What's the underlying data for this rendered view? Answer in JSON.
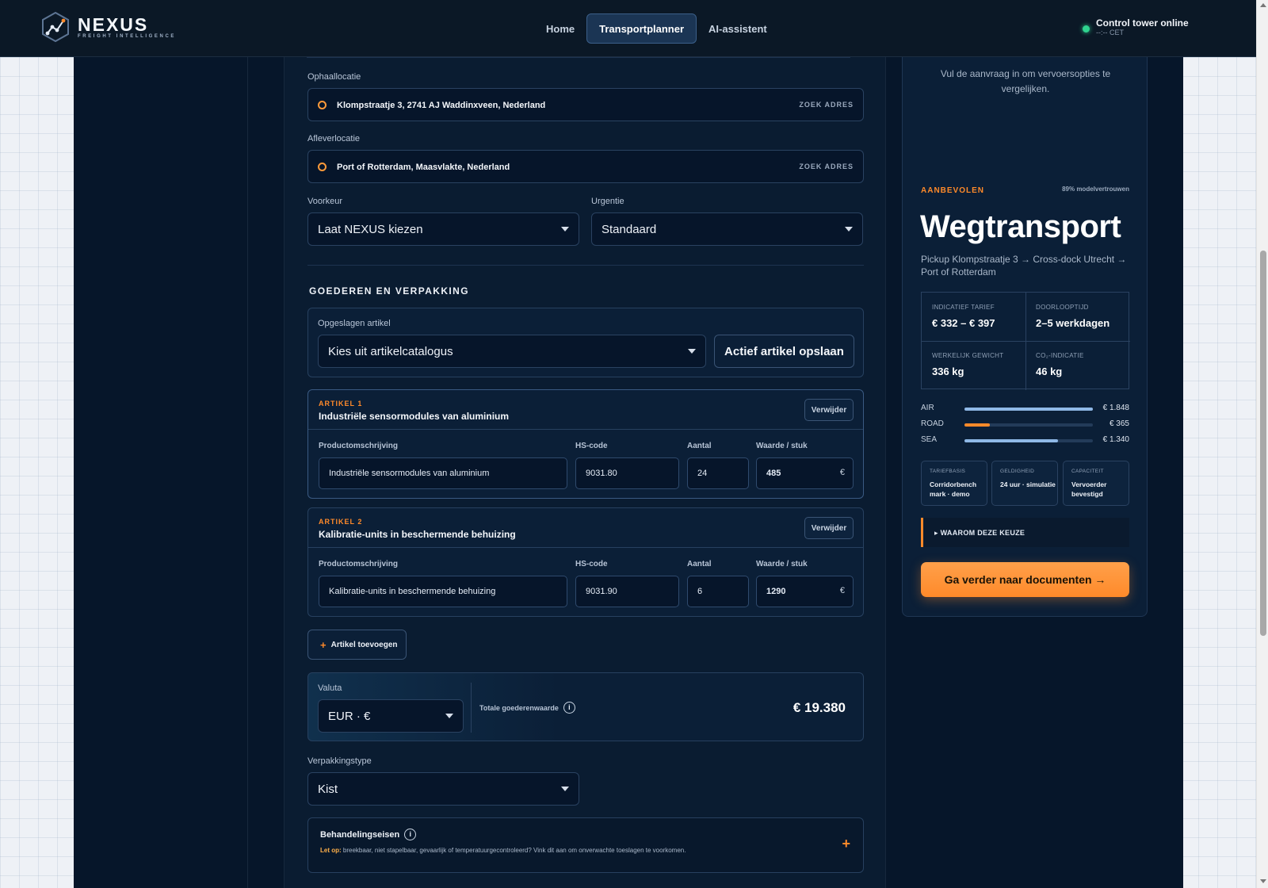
{
  "header": {
    "brand": "NEXUS",
    "brand_sub": "FREIGHT INTELLIGENCE",
    "nav": [
      {
        "label": "Home",
        "active": false
      },
      {
        "label": "Transportplanner",
        "active": true
      },
      {
        "label": "AI-assistent",
        "active": false
      }
    ],
    "status_title": "Control tower online",
    "status_sub": "--:-- CET",
    "status_color": "#2fd38f"
  },
  "route": {
    "pickup_label": "Ophaallocatie",
    "pickup_value": "Klompstraatje 3, 2741 AJ Waddinxveen, Nederland",
    "dropoff_label": "Afleverlocatie",
    "dropoff_value": "Port of Rotterdam, Maasvlakte, Nederland",
    "search_label": "ZOEK ADRES",
    "preference_label": "Voorkeur",
    "preference_value": "Laat NEXUS kiezen",
    "urgency_label": "Urgentie",
    "urgency_value": "Standaard"
  },
  "goods": {
    "section_title": "GOEDEREN EN VERPAKKING",
    "saved_label": "Opgeslagen artikel",
    "catalog_placeholder": "Kies uit artikelcatalogus",
    "save_button": "Actief artikel opslaan",
    "remove_label": "Verwijder",
    "col_description": "Productomschrijving",
    "col_hs": "HS-code",
    "col_qty": "Aantal",
    "col_value": "Waarde / stuk",
    "currency_symbol": "€",
    "articles": [
      {
        "num": "ARTIKEL 1",
        "title": "Industriële sensormodules van aluminium",
        "description": "Industriële sensormodules van aluminium",
        "hs": "9031.80",
        "qty": "24",
        "value": "485"
      },
      {
        "num": "ARTIKEL 2",
        "title": "Kalibratie-units in beschermende behuizing",
        "description": "Kalibratie-units in beschermende behuizing",
        "hs": "9031.90",
        "qty": "6",
        "value": "1290"
      }
    ],
    "add_article": "Artikel toevoegen",
    "currency_label": "Valuta",
    "currency_value": "EUR · €",
    "total_label": "Totale goederenwaarde",
    "total_value": "€ 19.380",
    "packaging_label": "Verpakkingstype",
    "packaging_value": "Kist",
    "handling_title": "Behandelingseisen",
    "handling_note_prefix": "Let op:",
    "handling_note": "breekbaar, niet stapelbaar, gevaarlijk of temperatuurgecontroleerd? Vink dit aan om onverwachte toeslagen te voorkomen."
  },
  "recommendation": {
    "intro": "Vul de aanvraag in om vervoersopties te vergelijken.",
    "badge": "AANBEVOLEN",
    "confidence": "89% modelvertrouwen",
    "mode": "Wegtransport",
    "route": "Pickup Klompstraatje 3 → Cross-dock Utrecht → Port of Rotterdam",
    "stats": [
      {
        "label": "INDICATIEF TARIEF",
        "value": "€ 332 – € 397"
      },
      {
        "label": "DOORLOOPTIJD",
        "value": "2–5 werkdagen"
      },
      {
        "label": "WERKELIJK GEWICHT",
        "value": "336 kg"
      },
      {
        "label": "CO₂-INDICATIE",
        "value": "46 kg"
      }
    ],
    "bars": [
      {
        "label": "AIR",
        "value": "€ 1.848",
        "fraction": 1.0,
        "color": "#8fb8e6"
      },
      {
        "label": "ROAD",
        "value": "€ 365",
        "fraction": 0.2,
        "color": "#ff8a2a"
      },
      {
        "label": "SEA",
        "value": "€ 1.340",
        "fraction": 0.73,
        "color": "#8fb8e6"
      }
    ],
    "mini": [
      {
        "label": "TARIEFBASIS",
        "value": "Corridorbench mark · demo"
      },
      {
        "label": "GELDIGHEID",
        "value": "24 uur · simulatie"
      },
      {
        "label": "CAPACITEIT",
        "value": "Vervoerder bevestigd"
      }
    ],
    "why_label": "WAAROM DEZE KEUZE",
    "cta": "Ga verder naar documenten →"
  }
}
